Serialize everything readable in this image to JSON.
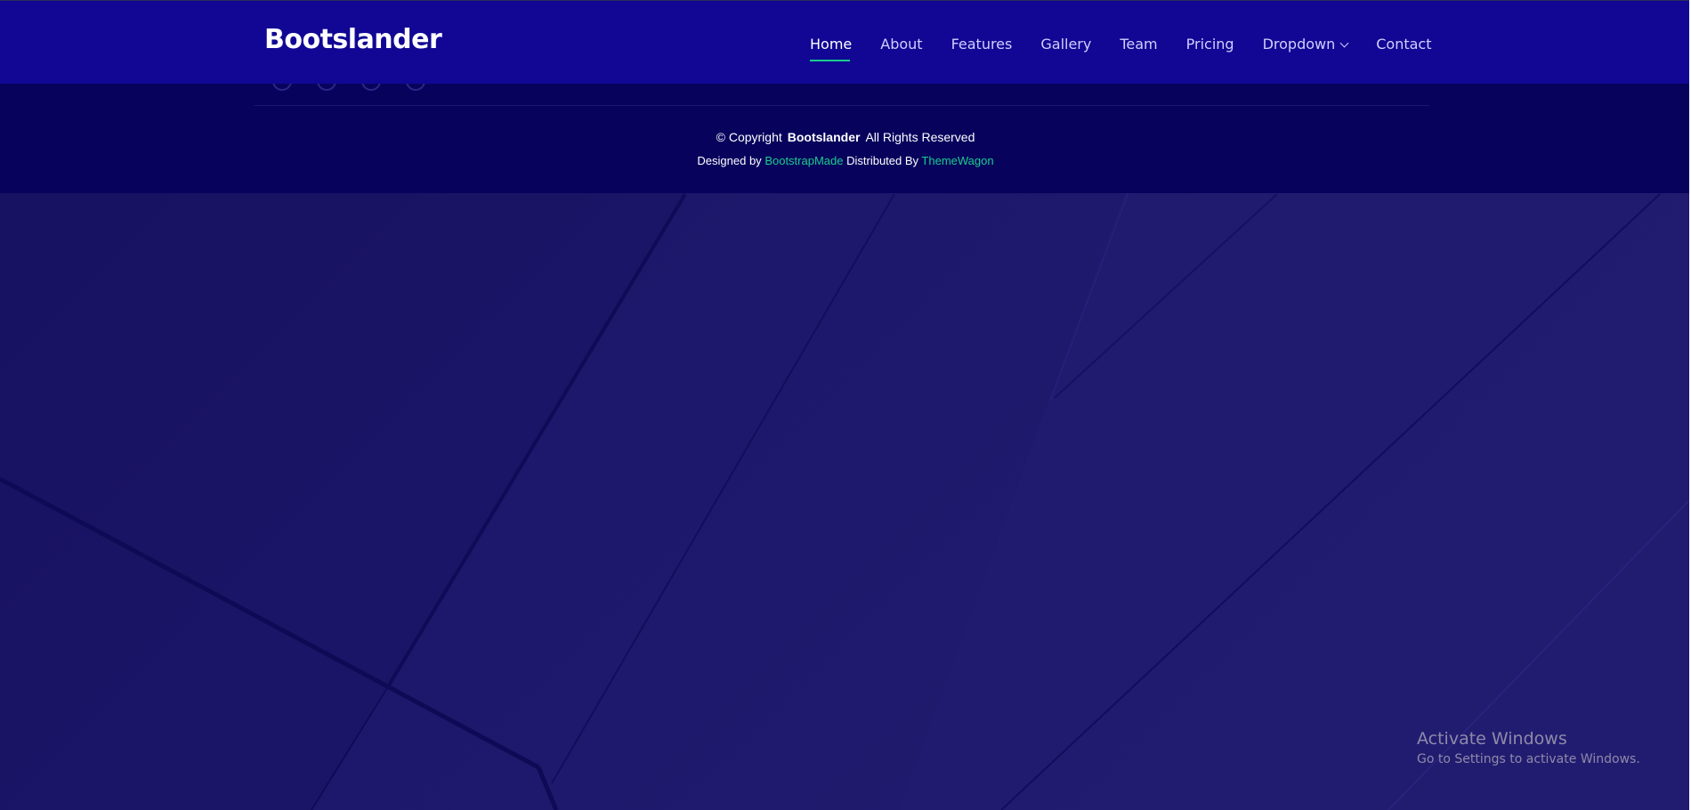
{
  "header": {
    "logo": "Bootslander",
    "nav": [
      {
        "label": "Home",
        "active": true
      },
      {
        "label": "About",
        "active": false
      },
      {
        "label": "Features",
        "active": false
      },
      {
        "label": "Gallery",
        "active": false
      },
      {
        "label": "Team",
        "active": false
      },
      {
        "label": "Pricing",
        "active": false
      },
      {
        "label": "Dropdown",
        "active": false,
        "icon": "chevron-down-icon"
      },
      {
        "label": "Contact",
        "active": false
      }
    ]
  },
  "footer": {
    "copyright_prefix": "© Copyright",
    "brand": "Bootslander",
    "rights": "All Rights Reserved",
    "designed_by": "Designed by",
    "designer": "BootstrapMade",
    "distributed_by": "Distributed By",
    "distributor": "ThemeWagon"
  },
  "watermark": {
    "title": "Activate Windows",
    "subtitle": "Go to Settings to activate Windows."
  },
  "colors": {
    "header_bg": "#110794",
    "footer_bg": "#07035d",
    "accent": "#1acc8d",
    "page_bg": "#1e1868"
  }
}
